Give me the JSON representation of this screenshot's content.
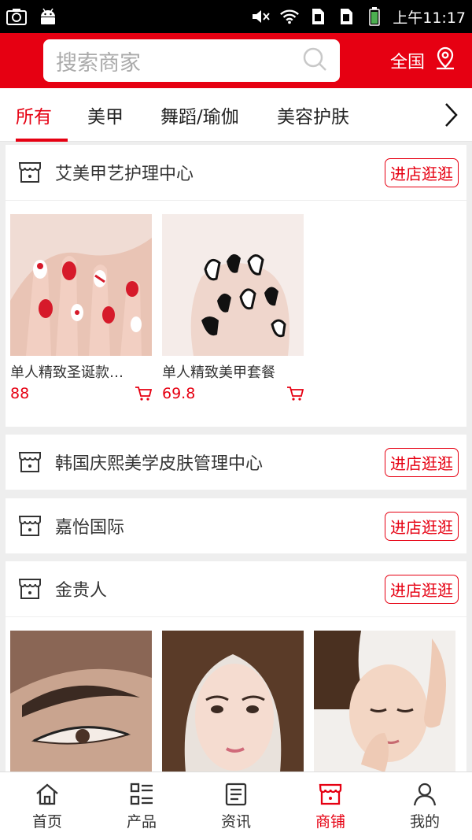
{
  "status_bar": {
    "time": "上午11:17"
  },
  "header": {
    "search_placeholder": "搜索商家",
    "region": "全国"
  },
  "tabs": [
    {
      "label": "所有",
      "active": true
    },
    {
      "label": "美甲"
    },
    {
      "label": "舞蹈/瑜伽"
    },
    {
      "label": "美容护肤"
    }
  ],
  "shops": [
    {
      "name": "艾美甲艺护理中心",
      "button": "进店逛逛",
      "products": [
        {
          "name": "单人精致圣诞款…",
          "price": "88"
        },
        {
          "name": "单人精致美甲套餐",
          "price": "69.8"
        }
      ]
    },
    {
      "name": "韩国庆熙美学皮肤管理中心",
      "button": "进店逛逛"
    },
    {
      "name": "嘉怡国际",
      "button": "进店逛逛"
    },
    {
      "name": "金贵人",
      "button": "进店逛逛"
    }
  ],
  "bottom_nav": [
    {
      "label": "首页",
      "icon": "home-icon"
    },
    {
      "label": "产品",
      "icon": "grid-list-icon"
    },
    {
      "label": "资讯",
      "icon": "news-icon"
    },
    {
      "label": "商铺",
      "icon": "store-icon",
      "active": true
    },
    {
      "label": "我的",
      "icon": "user-icon"
    }
  ],
  "colors": {
    "brand": "#e60012",
    "background": "#eeeeee"
  }
}
